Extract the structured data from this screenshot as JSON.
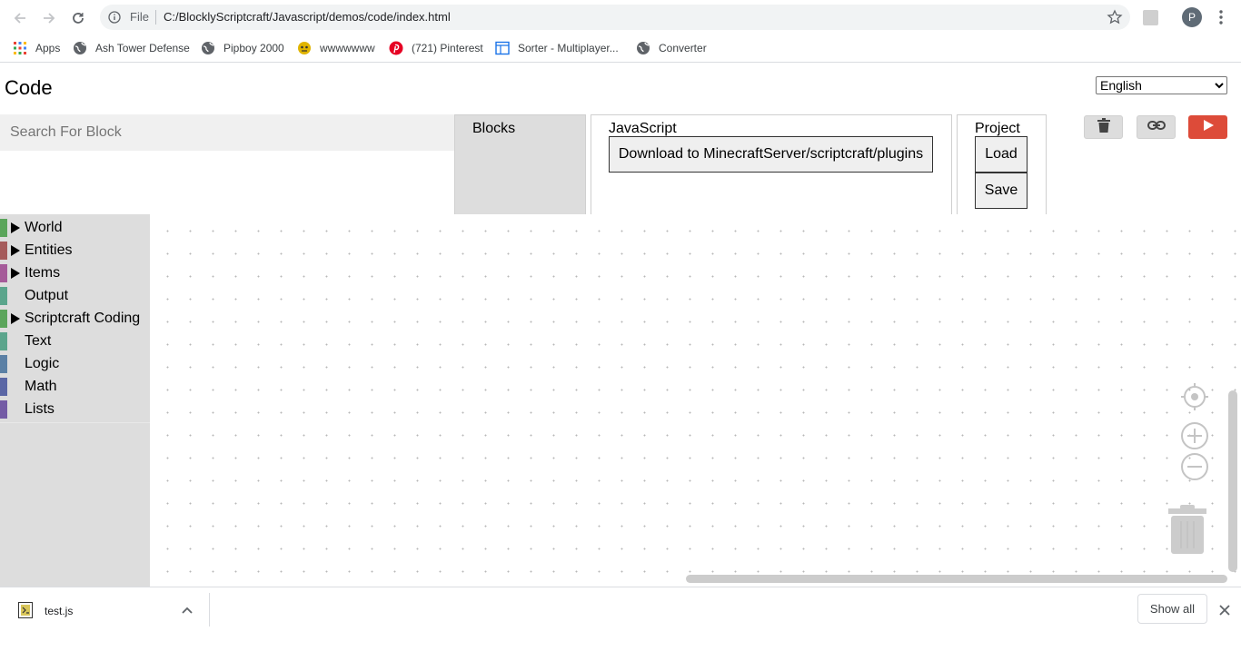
{
  "browser": {
    "scheme_label": "File",
    "url": "C:/BlocklyScriptcraft/Javascript/demos/code/index.html",
    "profile_initial": "P"
  },
  "bookmarks": [
    {
      "label": "Apps",
      "icon": "apps-grid-icon"
    },
    {
      "label": "Ash Tower Defense",
      "icon": "globe-icon"
    },
    {
      "label": "Pipboy 2000",
      "icon": "globe-icon"
    },
    {
      "label": "wwwwwww",
      "icon": "emoji-icon"
    },
    {
      "label": "(721) Pinterest",
      "icon": "pinterest-icon"
    },
    {
      "label": "Sorter - Multiplayer...",
      "icon": "window-icon"
    },
    {
      "label": "Converter",
      "icon": "globe-icon"
    }
  ],
  "page": {
    "title": "Code",
    "language": "English",
    "search_placeholder": "Search For Block"
  },
  "tabs": {
    "blocks_label": "Blocks",
    "javascript_label": "JavaScript",
    "download_button": "Download to MinecraftServer/scriptcraft/plugins",
    "project_label": "Project",
    "load_button": "Load",
    "save_button": "Save"
  },
  "toolbar": {
    "trash_icon": "trash-icon",
    "link_icon": "link-icon",
    "run_icon": "play-icon",
    "run_color": "#dd4b39"
  },
  "toolbox": {
    "categories": [
      {
        "name": "World",
        "color": "#5ba55b",
        "expandable": true
      },
      {
        "name": "Entities",
        "color": "#a55b5b",
        "expandable": true
      },
      {
        "name": "Items",
        "color": "#a55b99",
        "expandable": true
      },
      {
        "name": "Output",
        "color": "#5ba58c",
        "expandable": false
      },
      {
        "name": "Scriptcraft Coding",
        "color": "#5ba55b",
        "expandable": true
      },
      {
        "name": "Text",
        "color": "#5ba58c",
        "expandable": false
      },
      {
        "name": "Logic",
        "color": "#5b80a5",
        "expandable": false
      },
      {
        "name": "Math",
        "color": "#5b67a5",
        "expandable": false
      },
      {
        "name": "Lists",
        "color": "#745ba5",
        "expandable": false
      }
    ]
  },
  "download_bar": {
    "file_name": "test.js",
    "show_all": "Show all"
  }
}
